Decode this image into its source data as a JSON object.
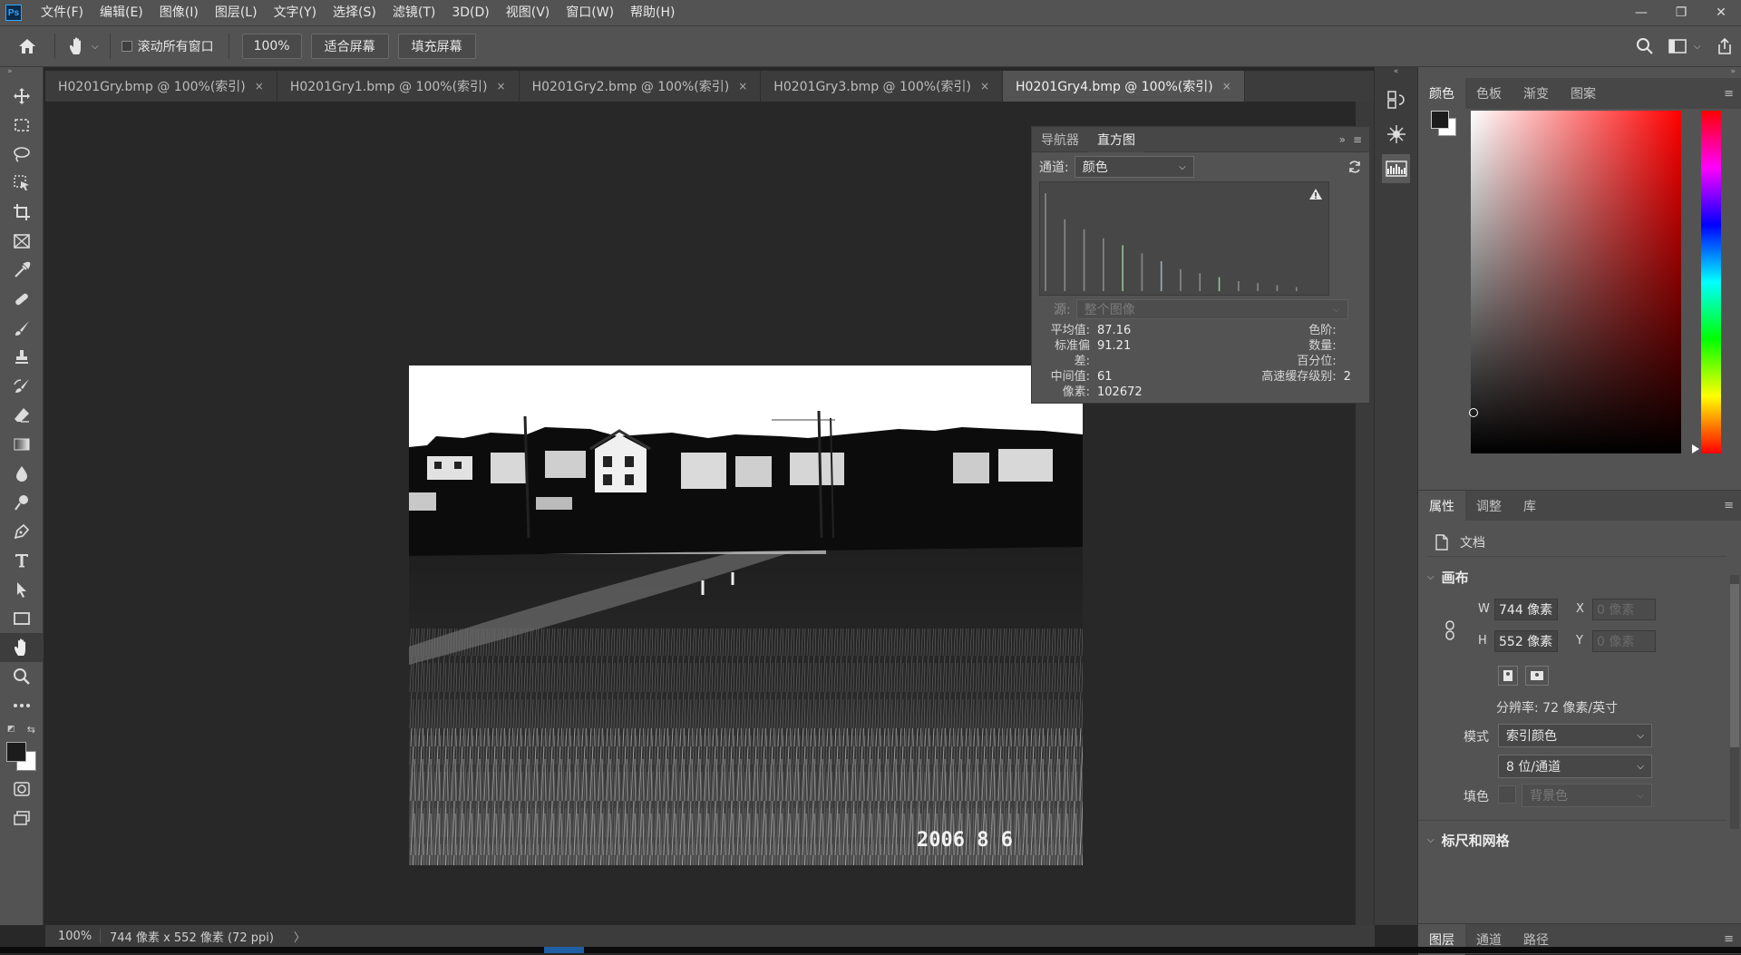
{
  "app": {
    "logo": "Ps"
  },
  "menu": [
    "文件(F)",
    "编辑(E)",
    "图像(I)",
    "图层(L)",
    "文字(Y)",
    "选择(S)",
    "滤镜(T)",
    "3D(D)",
    "视图(V)",
    "窗口(W)",
    "帮助(H)"
  ],
  "options": {
    "scroll_all_label": "滚动所有窗口",
    "zoom_value": "100%",
    "fit_screen": "适合屏幕",
    "fill_screen": "填充屏幕"
  },
  "tabs": [
    {
      "label": "H0201Gry.bmp @ 100%(索引)",
      "active": false
    },
    {
      "label": "H0201Gry1.bmp @ 100%(索引)",
      "active": false
    },
    {
      "label": "H0201Gry2.bmp @ 100%(索引)",
      "active": false
    },
    {
      "label": "H0201Gry3.bmp @ 100%(索引)",
      "active": false
    },
    {
      "label": "H0201Gry4.bmp @ 100%(索引)",
      "active": true
    }
  ],
  "tab_close": "×",
  "photo": {
    "date_stamp": "2006  8  6"
  },
  "status": {
    "zoom": "100%",
    "info": "744 像素 x 552 像素 (72 ppi)",
    "arrow": "〉"
  },
  "histogram": {
    "tab_navigator": "导航器",
    "tab_histogram": "直方图",
    "channel_label": "通道:",
    "channel_value": "颜色",
    "source_label": "源:",
    "source_value": "整个图像",
    "stats_left": [
      {
        "label": "平均值:",
        "value": "87.16"
      },
      {
        "label": "标准偏差:",
        "value": "91.21"
      },
      {
        "label": "中间值:",
        "value": "61"
      },
      {
        "label": "像素:",
        "value": "102672"
      }
    ],
    "stats_right": [
      {
        "label": "色阶:",
        "value": ""
      },
      {
        "label": "数量:",
        "value": ""
      },
      {
        "label": "百分位:",
        "value": ""
      },
      {
        "label": "高速缓存级别:",
        "value": "2"
      }
    ],
    "bars": [
      {
        "level": 0.98,
        "color": "#8a8a8a"
      },
      {
        "level": 0.72,
        "color": "#8a8a8a"
      },
      {
        "level": 0.62,
        "color": "#8a8a8a"
      },
      {
        "level": 0.53,
        "color": "#8a8a8a"
      },
      {
        "level": 0.46,
        "color": "#9ac09a"
      },
      {
        "level": 0.38,
        "color": "#8a8a8a"
      },
      {
        "level": 0.3,
        "color": "#9ab0c0"
      },
      {
        "level": 0.22,
        "color": "#8a8a8a"
      },
      {
        "level": 0.18,
        "color": "#8a8a8a"
      },
      {
        "level": 0.14,
        "color": "#9ac09a"
      },
      {
        "level": 0.1,
        "color": "#8a8a8a"
      },
      {
        "level": 0.08,
        "color": "#8a8a8a"
      },
      {
        "level": 0.06,
        "color": "#8a8a8a"
      },
      {
        "level": 0.04,
        "color": "#8a8a8a"
      }
    ]
  },
  "color_panel": {
    "tabs": [
      "颜色",
      "色板",
      "渐变",
      "图案"
    ]
  },
  "properties": {
    "tabs": [
      "属性",
      "调整",
      "库"
    ],
    "doc_label": "文档",
    "canvas_title": "画布",
    "w_label": "W",
    "w_value": "744 像素",
    "h_label": "H",
    "h_value": "552 像素",
    "x_label": "X",
    "x_placeholder": "0 像素",
    "y_label": "Y",
    "y_placeholder": "0 像素",
    "resolution": "分辨率: 72 像素/英寸",
    "mode_label": "模式",
    "mode_value": "索引颜色",
    "depth_value": "8 位/通道",
    "fill_label": "填色",
    "fill_value": "背景色",
    "rulers_title": "标尺和网格"
  },
  "layers": {
    "tabs": [
      "图层",
      "通道",
      "路径"
    ]
  }
}
